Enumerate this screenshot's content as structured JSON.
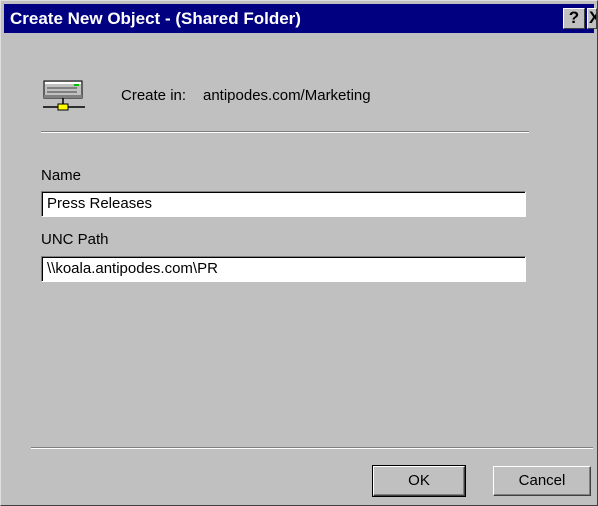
{
  "window": {
    "title": "Create New Object - (Shared Folder)",
    "help_glyph": "?",
    "close_glyph": "X"
  },
  "header": {
    "icon": "shared-folder-network-icon",
    "create_in_label": "Create in:",
    "create_in_path": "antipodes.com/Marketing"
  },
  "form": {
    "name_label": "Name",
    "name_value": "Press Releases",
    "unc_label": "UNC Path",
    "unc_value": "\\\\koala.antipodes.com\\PR"
  },
  "buttons": {
    "ok": "OK",
    "cancel": "Cancel"
  }
}
